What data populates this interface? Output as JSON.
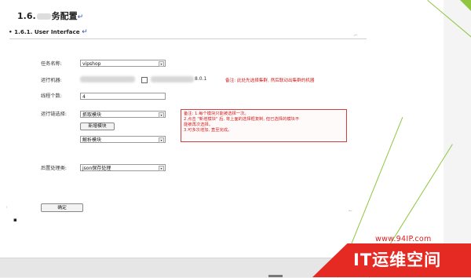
{
  "doc": {
    "section_number": "1.6.",
    "section_title_tail": "务配置",
    "para_mark": "↵",
    "subsection": "1.6.1. User Interface",
    "subsection_mark": "↵"
  },
  "form": {
    "task_name_label": "任务名称:",
    "task_name_value": "vipshop",
    "machine_label": "运行机器:",
    "machine_ip": "8.0.1",
    "machine_note": "备注: 此处先选择集群, 然后联动出集群的机器",
    "thread_count_label": "线程个数:",
    "thread_count_value": "4",
    "chain_label": "运行链选择:",
    "chain_select_1": "抓取模块",
    "add_module_button": "新增模块",
    "chain_select_2": "解析模块",
    "note_lines": [
      "备注: 1.每个模块只能被选择一次。",
      "2.点击 \"新增模块\" 后, 将上面的选择框复制, 但已选择的模块不",
      "能被再次选择。",
      "3.可多次增加, 直至完成。"
    ],
    "post_label": "后置处理类:",
    "post_value": "json保存处理",
    "confirm_button": "确定"
  },
  "watermark": {
    "url": "www.94IP.com",
    "brand": "IT运维空间"
  },
  "colors": {
    "accent_green": "#8fc63f",
    "note_red": "#d02020",
    "brand_red": "#e42a23"
  }
}
